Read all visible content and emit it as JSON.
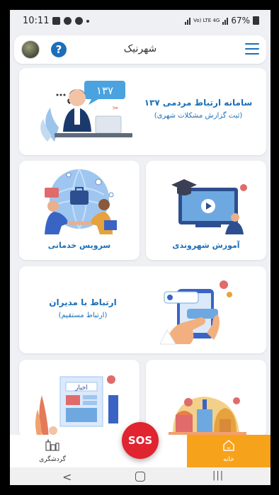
{
  "status_bar": {
    "time": "10:11",
    "network": "Vo) LTE 4G",
    "battery": "67%"
  },
  "app_bar": {
    "title": "شهرنیک",
    "help_symbol": "?"
  },
  "cards": {
    "hotline": {
      "title": "سامانه ارتباط مردمی ۱۳۷",
      "subtitle": "(ثبت گزارش مشکلات شهری)",
      "bubble_text": "۱۳۷",
      "illustration": "call-center-operator"
    },
    "education": {
      "title": "آموزش شهروندی",
      "illustration": "video-learning"
    },
    "services": {
      "title": "سرویس خدماتی",
      "illustration": "business-handshake-globe"
    },
    "managers": {
      "title": "ارتباط با مدیران",
      "subtitle": "(ارتباط مستقیم)",
      "illustration": "phone-messaging"
    },
    "news": {
      "sign_text": "اخبار",
      "illustration": "newspaper-kiosk"
    },
    "tourism": {
      "illustration": "city-landmarks"
    }
  },
  "bottom_nav": {
    "home_label": "خانه",
    "tourism_label": "گردشگری",
    "sos_label": "SOS"
  },
  "colors": {
    "primary_blue": "#1b6fb8",
    "home_orange": "#f7a21b",
    "sos_red": "#e02430",
    "background": "#eef0f3"
  }
}
